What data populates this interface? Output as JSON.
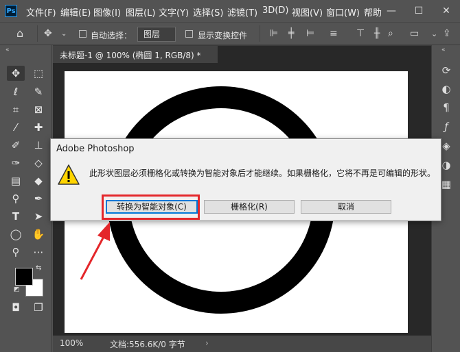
{
  "app": {
    "logo": "Ps"
  },
  "menu": [
    "文件(F)",
    "编辑(E)",
    "图像(I)",
    "图层(L)",
    "文字(Y)",
    "选择(S)",
    "滤镜(T)",
    "3D(D)",
    "视图(V)",
    "窗口(W)",
    "帮助"
  ],
  "window_controls": {
    "minimize": "—",
    "restore": "☐",
    "close": "✕"
  },
  "options": {
    "auto_select_label": "自动选择：",
    "auto_select_value": "图层",
    "show_transform_label": "显示变换控件"
  },
  "document": {
    "tab_title": "未标题-1 @ 100% (椭圆 1, RGB/8) *",
    "zoom": "100%",
    "doc_size": "文档:556.6K/0 字节"
  },
  "dialog": {
    "title": "Adobe Photoshop",
    "message": "此形状图层必须栅格化或转换为智能对象后才能继续。如果栅格化，它将不再是可编辑的形状。",
    "buttons": {
      "convert": "转换为智能对象(C)",
      "rasterize": "栅格化(R)",
      "cancel": "取消"
    },
    "icon": "warning-icon"
  },
  "colors": {
    "accent_highlight": "#e4262a",
    "default_button_border": "#0078d7",
    "ui_background": "#535353",
    "workspace": "#282828"
  }
}
